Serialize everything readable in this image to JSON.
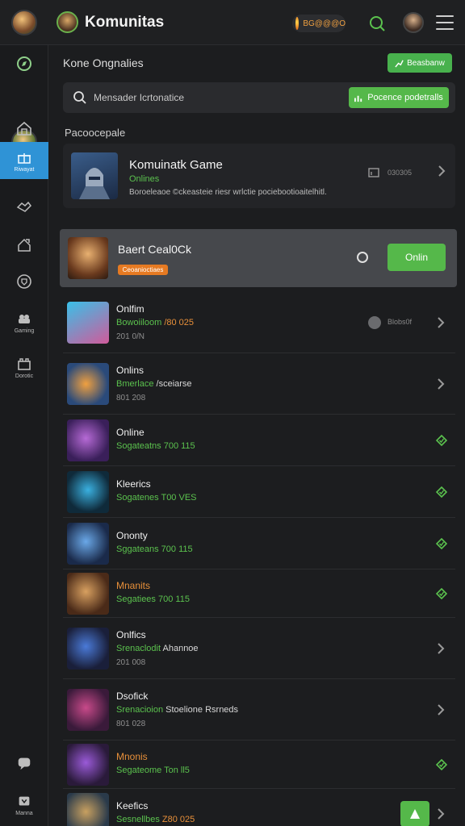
{
  "topbar": {
    "title": "Komunitas",
    "coins": "BG@@@O"
  },
  "sidebar": {
    "items": [
      {
        "label": "",
        "icon": "compass-icon"
      },
      {
        "label": "",
        "icon": "home-icon"
      },
      {
        "label": "Riwayat",
        "icon": "gift-icon",
        "active": true
      },
      {
        "label": "",
        "icon": "handshake-icon"
      },
      {
        "label": "",
        "icon": "house-icon"
      },
      {
        "label": "",
        "icon": "shield-icon"
      },
      {
        "label": "Gaming",
        "icon": "gamepad-icon"
      },
      {
        "label": "Dorotic",
        "icon": "store-icon"
      }
    ],
    "bottom_items": [
      {
        "label": "",
        "icon": "chat-icon"
      },
      {
        "label": "Manna",
        "icon": "trophy-icon"
      }
    ]
  },
  "main": {
    "section_title": "Kone Ongnalies",
    "top_button": "Beasbanw",
    "search_placeholder": "Mensader Icrtonatice",
    "search_button": "Pocence podetralls",
    "subheading": "Pacoocepale",
    "featured": {
      "name": "Komuinatk Game",
      "status": "Onlines",
      "description": "Boroeleaoe ©ckeasteie riesr wrlctie pociebootioaitelhitl.",
      "stat": "030305"
    },
    "highlight": {
      "name": "Baert Ceal0Ck",
      "badge": "Ceoanioctiaes",
      "button": "Onlin"
    },
    "rows": [
      {
        "name": "Onlfim",
        "l1a": "Bowoiiloom",
        "l1b": "/80 025",
        "l1b_color": "orange",
        "l2": "201 0/N",
        "right": "dot-chev",
        "right_text": "Blobs0f"
      },
      {
        "name": "Onlins",
        "l1a": "Bmerlace",
        "l1b": "/sceiarse",
        "l1b_color": "white",
        "l2": "801 208",
        "right": "chev"
      },
      {
        "name": "Online",
        "l1a": "Sogateatns",
        "l1b": "700 115",
        "l1b_color": "green",
        "l2": "",
        "right": "diamond"
      },
      {
        "name": "Kleerics",
        "l1a": "Sogatenes",
        "l1b": "T00 VES",
        "l1b_color": "green",
        "l2": "",
        "right": "diamond"
      },
      {
        "name": "Ononty",
        "l1a": "Sggateans",
        "l1b": "700 115",
        "l1b_color": "green",
        "l2": "",
        "right": "diamond"
      },
      {
        "name": "Mnanits",
        "name_color": "orange",
        "l1a": "Segatiees",
        "l1b": "700 115",
        "l1b_color": "green",
        "l2": "",
        "right": "diamond"
      },
      {
        "name": "Onlfics",
        "l1a": "Srenaclodit",
        "l1b": "Ahannoe",
        "l1b_color": "white",
        "l2": "201 008",
        "right": "chev"
      },
      {
        "name": "Dsofick",
        "l1a": "Srenacioion",
        "l1b": "Stoelione Rsrneds",
        "l1b_color": "white",
        "l2": "801 028",
        "right": "chev"
      },
      {
        "name": "Mnonis",
        "name_color": "orange",
        "l1a": "Segateome",
        "l1b": "Ton ll5",
        "l1b_color": "green",
        "l2": "",
        "right": "diamond"
      },
      {
        "name": "Keefics",
        "l1a": "Sesnellbes",
        "l1b": "Z80 025",
        "l1b_color": "orange",
        "l2": "",
        "right": "btn-chev"
      }
    ]
  },
  "colors": {
    "accent_green": "#55b84a",
    "active_blue": "#2f93d6",
    "warning_orange": "#e67a22"
  }
}
